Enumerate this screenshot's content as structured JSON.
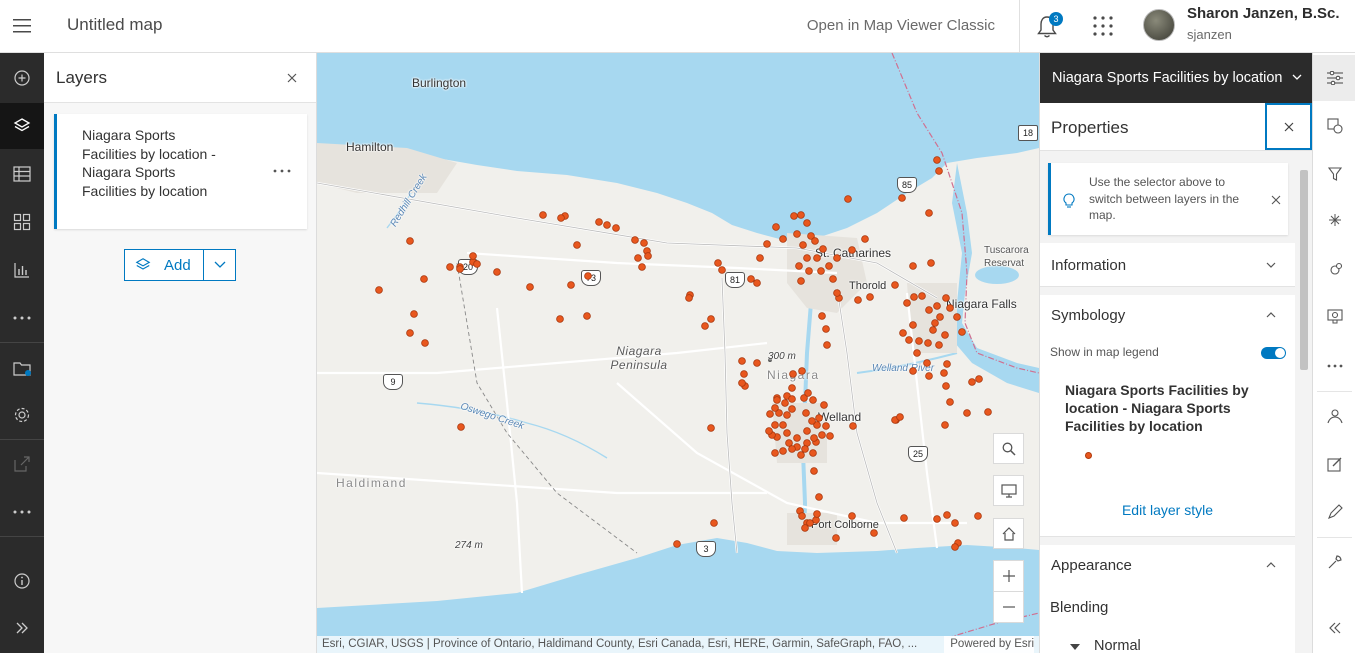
{
  "header": {
    "title": "Untitled map",
    "open_classic": "Open in Map Viewer Classic",
    "notification_count": "3",
    "user_name": "Sharon Janzen, B.Sc.",
    "user_id": "sjanzen"
  },
  "left_rail": {
    "items": [
      "add-icon",
      "layers-icon",
      "tables-icon",
      "basemap-icon",
      "charts-icon",
      "more-icon",
      "save-icon",
      "settings-icon",
      "share-icon",
      "more-icon",
      "info-icon",
      "expand-icon"
    ]
  },
  "layers_panel": {
    "title": "Layers",
    "layer_name": "Niagara Sports Facilities by location - Niagara Sports Facilities by location",
    "add_label": "Add"
  },
  "map": {
    "labels": {
      "burlington": "Burlington",
      "hamilton": "Hamilton",
      "st_catharines": "St. Catharines",
      "thorold": "Thorold",
      "niagara_falls": "Niagara Falls",
      "tuscarora": "Tuscarora Reservat",
      "niagara_peninsula": "Niagara Peninsula",
      "niagara": "Niagara",
      "welland": "Welland",
      "port_colborne": "Port Colborne",
      "haldimand": "Haldimand",
      "welland_river": "Welland River",
      "oswego_creek": "Oswego Creek",
      "redhill_creek": "Redhill Creek",
      "elev_300": "300 m",
      "elev_274": "274 m"
    },
    "shields": [
      "18",
      "85",
      "20",
      "73",
      "81",
      "9",
      "25",
      "3"
    ],
    "attribution": "Esri, CGIAR, USGS | Province of Ontario, Haldimand County, Esri Canada, Esri, HERE, Garmin, SafeGraph, FAO, ...",
    "powered_by": "Powered by Esri",
    "point_color": "#e8571e"
  },
  "properties": {
    "layer_selector": "Niagara Sports Facilities by location",
    "title": "Properties",
    "tip": "Use the selector above to switch between layers in the map.",
    "information": "Information",
    "symbology": "Symbology",
    "show_in_legend": "Show in map legend",
    "legend_layer_name": "Niagara Sports Facilities by location - Niagara Sports Facilities by location",
    "edit_style": "Edit layer style",
    "appearance": "Appearance",
    "blending": "Blending",
    "blend_value": "Normal"
  },
  "right_rail": {
    "items": [
      "properties-icon",
      "styles-icon",
      "filter-icon",
      "effects-icon",
      "pop-ups-icon",
      "fields-icon",
      "more-icon",
      "clustering-icon",
      "sketch-icon",
      "edit-icon",
      "analysis-icon",
      "collapse-icon"
    ]
  }
}
